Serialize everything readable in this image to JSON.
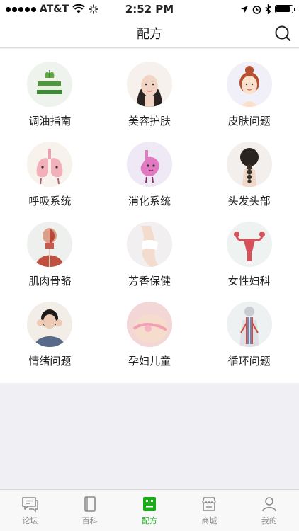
{
  "status_bar": {
    "carrier": "AT&T",
    "time": "2:52 PM"
  },
  "nav": {
    "title": "配方"
  },
  "categories": [
    {
      "label": "调油指南",
      "icon": "books-icon"
    },
    {
      "label": "美容护肤",
      "icon": "face-beauty-icon"
    },
    {
      "label": "皮肤问题",
      "icon": "skin-girl-icon"
    },
    {
      "label": "呼吸系统",
      "icon": "lungs-icon"
    },
    {
      "label": "消化系统",
      "icon": "stomach-icon"
    },
    {
      "label": "头发头部",
      "icon": "hair-braid-icon"
    },
    {
      "label": "肌肉骨骼",
      "icon": "anatomy-icon"
    },
    {
      "label": "芳香保健",
      "icon": "body-icon"
    },
    {
      "label": "女性妇科",
      "icon": "uterus-icon"
    },
    {
      "label": "情绪问题",
      "icon": "stressed-woman-icon"
    },
    {
      "label": "孕妇儿童",
      "icon": "pregnant-icon"
    },
    {
      "label": "循环问题",
      "icon": "circulation-icon"
    }
  ],
  "tabs": [
    {
      "label": "论坛",
      "icon": "chat-icon",
      "active": false
    },
    {
      "label": "百科",
      "icon": "book-icon",
      "active": false
    },
    {
      "label": "配方",
      "icon": "recipe-icon",
      "active": true
    },
    {
      "label": "商城",
      "icon": "store-icon",
      "active": false
    },
    {
      "label": "我的",
      "icon": "person-icon",
      "active": false
    }
  ],
  "colors": {
    "accent": "#1aad19",
    "tab_inactive": "#8a8a8a"
  }
}
